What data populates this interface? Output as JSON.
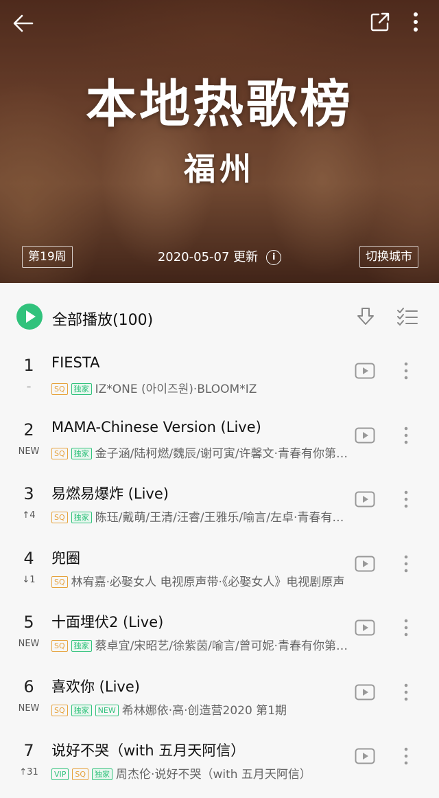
{
  "header": {
    "title": "本地热歌榜",
    "city": "福州",
    "week": "第19周",
    "update": "2020-05-07 更新",
    "info_icon": "i",
    "switch_city": "切换城市"
  },
  "toolbar": {
    "play_all": "全部播放(100)"
  },
  "songs": [
    {
      "rank": "1",
      "change": "–",
      "title": "FIESTA",
      "badges": [
        "SQ",
        "独家"
      ],
      "meta": "IZ*ONE (아이즈원)·BLOOM*IZ"
    },
    {
      "rank": "2",
      "change": "NEW",
      "title": "MAMA-Chinese Version (Live)",
      "badges": [
        "SQ",
        "独家"
      ],
      "meta": "金子涵/陆柯燃/魏辰/谢可寅/许馨文·青春有你第二季"
    },
    {
      "rank": "3",
      "change": "↑4",
      "title": "易燃易爆炸 (Live)",
      "badges": [
        "SQ",
        "独家"
      ],
      "meta": "陈珏/戴萌/王清/汪睿/王雅乐/喻言/左卓·青春有你第二季"
    },
    {
      "rank": "4",
      "change": "↓1",
      "title": "兜圈",
      "badges": [
        "SQ"
      ],
      "meta": "林宥嘉·必娶女人 电视原声带·《必娶女人》电视剧原声"
    },
    {
      "rank": "5",
      "change": "NEW",
      "title": "十面埋伏2 (Live)",
      "badges": [
        "SQ",
        "独家"
      ],
      "meta": "蔡卓宜/宋昭艺/徐紫茵/喻言/曾可妮·青春有你第二季"
    },
    {
      "rank": "6",
      "change": "NEW",
      "title": "喜欢你 (Live)",
      "badges": [
        "SQ",
        "独家",
        "NEW"
      ],
      "meta": "希林娜依·高·创造营2020 第1期"
    },
    {
      "rank": "7",
      "change": "↑31",
      "title": "说好不哭（with 五月天阿信）",
      "badges": [
        "VIP",
        "SQ",
        "独家"
      ],
      "meta": "周杰伦·说好不哭（with 五月天阿信）"
    }
  ],
  "colors": {
    "accent": "#31c27c",
    "sq": "#e6a23c"
  }
}
